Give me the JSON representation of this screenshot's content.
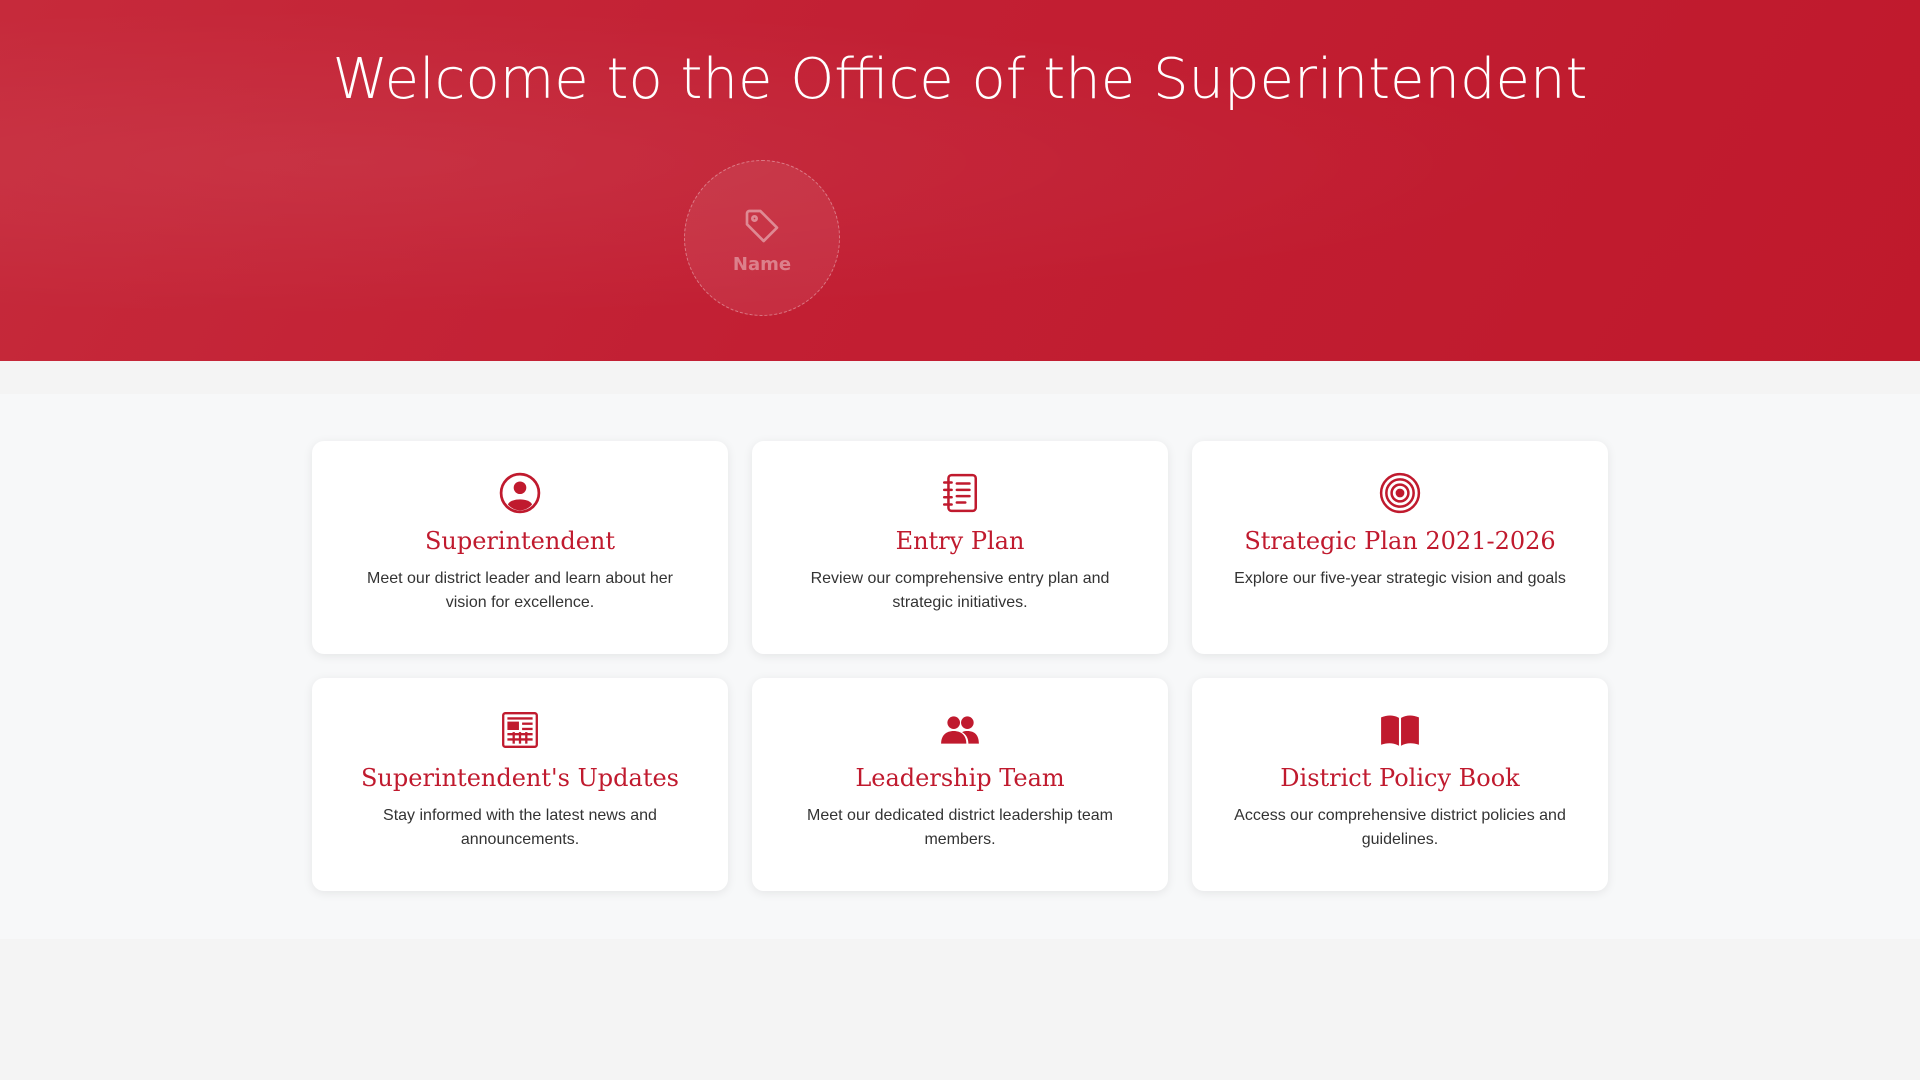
{
  "hero": {
    "title": "Welcome to the Office of the Superintendent",
    "name_badge": {
      "label": "Name",
      "icon": "tag-icon"
    }
  },
  "cards": [
    {
      "icon": "user-circle-icon",
      "title": "Superintendent",
      "description": "Meet our district leader and learn about her vision for excellence."
    },
    {
      "icon": "notebook-icon",
      "title": "Entry Plan",
      "description": "Review our comprehensive entry plan and strategic initiatives."
    },
    {
      "icon": "target-icon",
      "title": "Strategic Plan 2021-2026",
      "description": "Explore our five-year strategic vision and goals"
    },
    {
      "icon": "newspaper-icon",
      "title": "Superintendent's Updates",
      "description": "Stay informed with the latest news and announcements."
    },
    {
      "icon": "users-icon",
      "title": "Leadership Team",
      "description": "Meet our dedicated district leadership team members."
    },
    {
      "icon": "open-book-icon",
      "title": "District Policy Book",
      "description": "Access our comprehensive district policies and guidelines."
    }
  ],
  "colors": {
    "brand_red": "#c01a2e",
    "hero_bg": "#c21f33",
    "page_bg": "#f4f4f4"
  }
}
